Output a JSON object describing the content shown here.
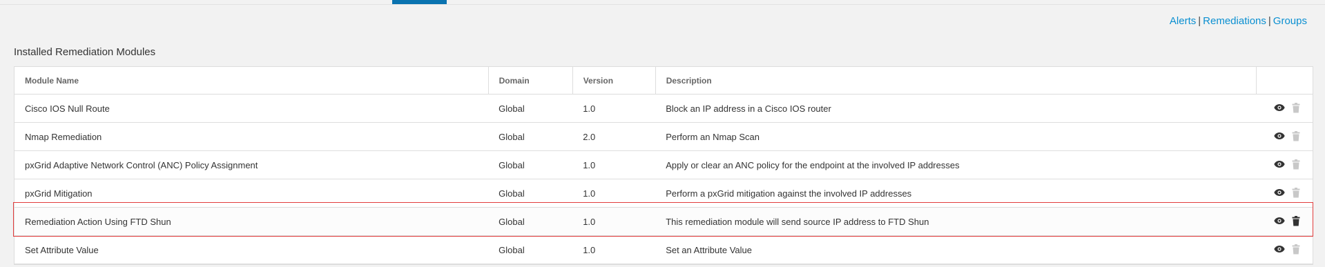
{
  "nav": {
    "links": [
      {
        "label": "Alerts"
      },
      {
        "label": "Remediations"
      },
      {
        "label": "Groups"
      }
    ],
    "separator": "|"
  },
  "section_title": "Installed Remediation Modules",
  "table": {
    "columns": [
      "Module Name",
      "Domain",
      "Version",
      "Description",
      ""
    ],
    "rows": [
      {
        "name": "Cisco IOS Null Route",
        "domain": "Global",
        "version": "1.0",
        "description": "Block an IP address in a Cisco IOS router",
        "delete_enabled": false
      },
      {
        "name": "Nmap Remediation",
        "domain": "Global",
        "version": "2.0",
        "description": "Perform an Nmap Scan",
        "delete_enabled": false
      },
      {
        "name": "pxGrid Adaptive Network Control (ANC) Policy Assignment",
        "domain": "Global",
        "version": "1.0",
        "description": "Apply or clear an ANC policy for the endpoint at the involved IP addresses",
        "delete_enabled": false
      },
      {
        "name": "pxGrid Mitigation",
        "domain": "Global",
        "version": "1.0",
        "description": "Perform a pxGrid mitigation against the involved IP addresses",
        "delete_enabled": false
      },
      {
        "name": "Remediation Action Using FTD Shun",
        "domain": "Global",
        "version": "1.0",
        "description": "This remediation module will send source IP address to FTD Shun",
        "delete_enabled": true
      },
      {
        "name": "Set Attribute Value",
        "domain": "Global",
        "version": "1.0",
        "description": "Set an Attribute Value",
        "delete_enabled": false
      }
    ]
  },
  "icons": {
    "view": "eye-icon",
    "delete": "trash-icon"
  },
  "colors": {
    "link": "#0a8fd1",
    "active_tab": "#0a73b0",
    "highlight_border": "#e23b3b",
    "icon_active": "#333333",
    "icon_disabled": "#c8c8c8"
  }
}
